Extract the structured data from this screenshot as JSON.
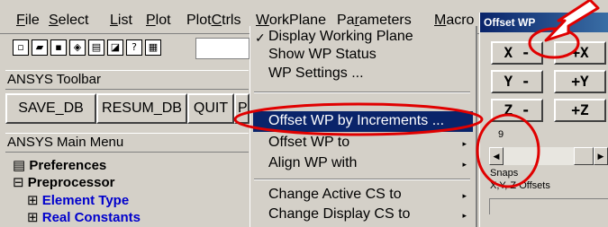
{
  "menubar": {
    "items": [
      {
        "label": "File",
        "u": "F",
        "rest": "ile"
      },
      {
        "label": "Select",
        "u": "S",
        "rest": "elect"
      },
      {
        "label": "List",
        "u": "L",
        "rest": "ist"
      },
      {
        "label": "Plot",
        "u": "P",
        "rest": "lot"
      },
      {
        "label": "PlotCtrls",
        "pre": "Plot",
        "u": "C",
        "rest": "trls"
      },
      {
        "label": "WorkPlane",
        "u": "W",
        "rest": "orkPlane"
      },
      {
        "label": "Parameters",
        "pre": "Pa",
        "u": "r",
        "rest": "ameters"
      },
      {
        "label": "Macro",
        "u": "M",
        "rest": "acro"
      }
    ]
  },
  "toolbar_icons": [
    "new-icon",
    "open-icon",
    "save-icon",
    "report-icon",
    "print-icon",
    "image-icon",
    "help-icon",
    "grid-icon"
  ],
  "ansys_toolbar": {
    "title": "ANSYS Toolbar",
    "buttons": [
      "SAVE_DB",
      "RESUM_DB",
      "QUIT",
      "P"
    ]
  },
  "main_menu": {
    "title": "ANSYS Main Menu",
    "items": [
      {
        "marker": "▤",
        "label": "Preferences",
        "level": 1
      },
      {
        "marker": "⊟",
        "label": "Preprocessor",
        "level": 1
      },
      {
        "marker": "⊞",
        "label": "Element Type",
        "level": 2
      },
      {
        "marker": "⊞",
        "label": "Real Constants",
        "level": 2
      }
    ]
  },
  "workplane_menu": {
    "items": [
      {
        "label": "Display Working Plane",
        "checked": true,
        "submenu": false
      },
      {
        "label": "Show WP Status",
        "checked": false,
        "submenu": false
      },
      {
        "label": "WP Settings ...",
        "checked": false,
        "submenu": false
      },
      {
        "label": "Offset WP by Increments ...",
        "checked": false,
        "submenu": false,
        "selected": true
      },
      {
        "label": "Offset WP to",
        "checked": false,
        "submenu": true
      },
      {
        "label": "Align WP with",
        "checked": false,
        "submenu": true
      },
      {
        "label": "Change Active CS to",
        "checked": false,
        "submenu": true
      },
      {
        "label": "Change Display CS to",
        "checked": false,
        "submenu": true
      }
    ],
    "check_glyph": "✓",
    "arrow_glyph": "▸"
  },
  "offset_wp": {
    "title": "Offset WP",
    "buttons": [
      "X -",
      "+X",
      "Y -",
      "+Y",
      "Z -",
      "+Z"
    ],
    "slider_value": "9",
    "snaps_label": "Snaps",
    "offsets_label": "X,Y, Z Offsets"
  },
  "colors": {
    "annotation": "#e00000",
    "selection": "#0a246a",
    "tree_blue": "#0000cc"
  }
}
